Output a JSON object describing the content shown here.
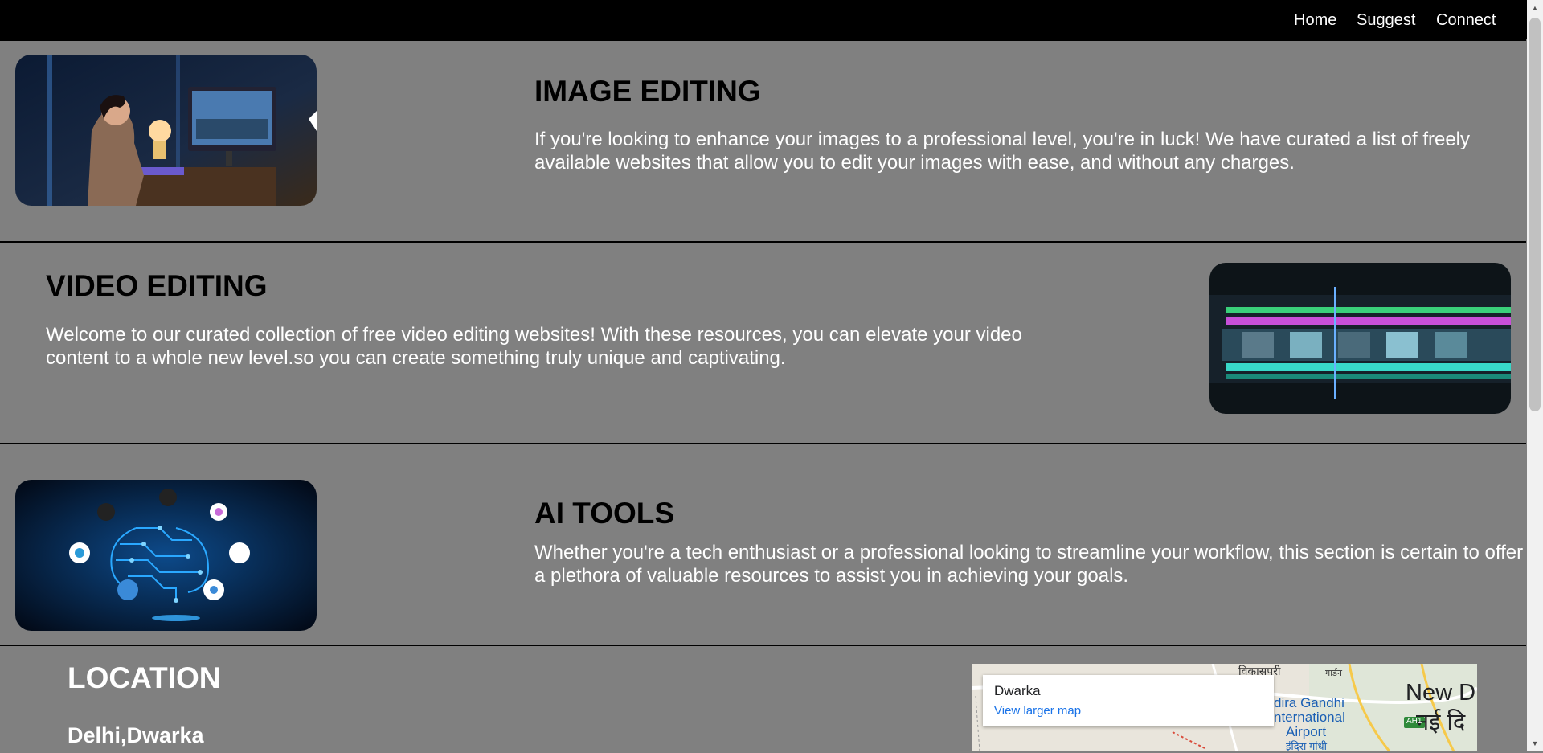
{
  "nav": {
    "items": [
      "Home",
      "Suggest",
      "Connect"
    ]
  },
  "sections": [
    {
      "heading": "IMAGE EDITING",
      "text": "If you're looking to enhance your images to a professional level, you're in luck! We have curated a list of freely available websites that allow you to edit your images with ease, and without any charges."
    },
    {
      "heading": "VIDEO EDITING",
      "text": "Welcome to our curated collection of free video editing websites! With these resources, you can elevate your video content to a whole new level.so you can create something truly unique and captivating."
    },
    {
      "heading": "AI TOOLS",
      "text": "Whether you're a tech enthusiast or a professional looking to streamline your workflow, this section is certain to offer a plethora of valuable resources to assist you in achieving your goals."
    }
  ],
  "location": {
    "title": "LOCATION",
    "subtitle": "Delhi,Dwarka",
    "map": {
      "place": "Dwarka",
      "link": "View larger map",
      "labels": [
        "विकासपुरी",
        "गार्डन",
        "New D",
        "नई दि",
        "dira Gandhi",
        "nternational",
        "Airport",
        "इंदिरा गांधी",
        "AH1"
      ]
    }
  },
  "colors": {
    "page_background": "#808080",
    "navbar": "#000000",
    "heading": "#000000",
    "body_text": "#ffffff",
    "map_link": "#1a73e8"
  }
}
